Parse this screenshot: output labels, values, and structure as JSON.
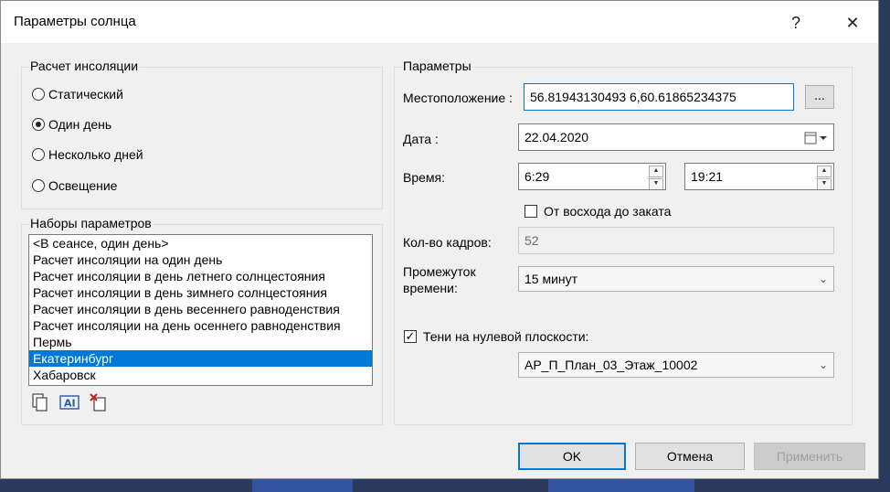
{
  "window": {
    "title": "Параметры солнца",
    "help_glyph": "?",
    "close_glyph": "✕"
  },
  "insolation": {
    "group_label": "Расчет инсоляции",
    "options": [
      {
        "label": "Статический",
        "selected": false
      },
      {
        "label": "Один день",
        "selected": true
      },
      {
        "label": "Несколько дней",
        "selected": false
      },
      {
        "label": "Освещение",
        "selected": false
      }
    ]
  },
  "presets": {
    "group_label": "Наборы параметров",
    "items": [
      "<В сеансе, один день>",
      "Расчет инсоляции на один день",
      "Расчет инсоляции в день летнего солнцестояния",
      "Расчет инсоляции в день зимнего солнцестояния",
      "Расчет инсоляции в день весеннего равноденствия",
      "Расчет инсоляции на день осеннего равноденствия",
      "Пермь",
      "Екатеринбург",
      "Хабаровск"
    ],
    "selected_item": "Екатеринбург",
    "tool_icons": [
      "duplicate-icon",
      "rename-icon",
      "delete-icon"
    ]
  },
  "params": {
    "group_label": "Параметры",
    "location_label": "Местоположение :",
    "location_value": "56.81943130493 6,60.61865234375",
    "browse_label": "...",
    "date_label": "Дата :",
    "date_value": "22.04.2020",
    "time_label": "Время:",
    "time_start": "6:29",
    "time_end": "19:21",
    "sunrise_label": "От восхода до заката",
    "sunrise_checked": false,
    "frames_label": "Кол-во кадров:",
    "frames_value": "52",
    "interval_label_line1": "Промежуток",
    "interval_label_line2": "времени:",
    "interval_value": "15 минут",
    "ground_shadows_label": "Тени на нулевой плоскости:",
    "ground_shadows_checked": true,
    "level_value": "АР_П_План_03_Этаж_10002"
  },
  "footer": {
    "ok_label": "OK",
    "cancel_label": "Отмена",
    "apply_label": "Применить"
  },
  "colors": {
    "selection": "#0078d7",
    "dialog_bg": "#f0f0f0",
    "backdrop": "#2a3a5c"
  }
}
